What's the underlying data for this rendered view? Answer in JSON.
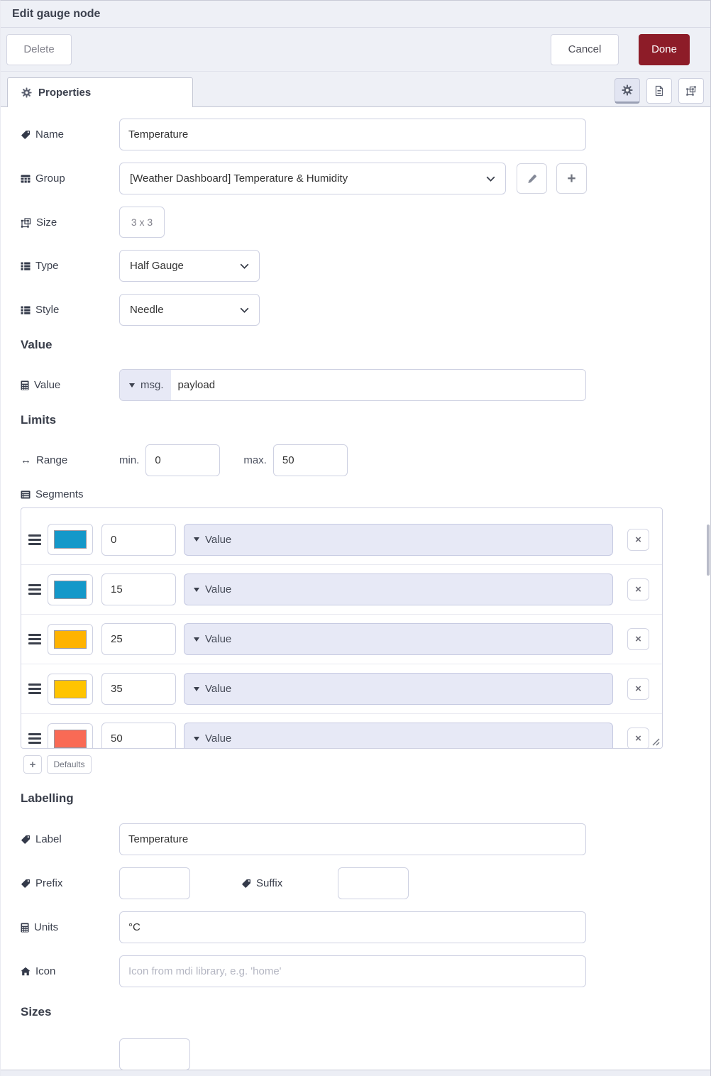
{
  "header": {
    "title": "Edit gauge node"
  },
  "toolbar": {
    "delete": "Delete",
    "cancel": "Cancel",
    "done": "Done"
  },
  "tabs": {
    "properties": "Properties"
  },
  "form": {
    "name": {
      "label": "Name",
      "value": "Temperature"
    },
    "group": {
      "label": "Group",
      "value": "[Weather Dashboard] Temperature & Humidity"
    },
    "size": {
      "label": "Size",
      "value": "3 x 3"
    },
    "type": {
      "label": "Type",
      "value": "Half Gauge"
    },
    "style": {
      "label": "Style",
      "value": "Needle"
    },
    "value_section": {
      "heading": "Value",
      "label": "Value",
      "prop_type": "msg.",
      "prop_value": "payload"
    },
    "limits": {
      "heading": "Limits",
      "range_label": "Range",
      "min_label": "min.",
      "min_value": "0",
      "max_label": "max.",
      "max_value": "50",
      "segments_label": "Segments",
      "segments": [
        {
          "color": "#1498c9",
          "value": "0",
          "type": "Value",
          "speckled": false
        },
        {
          "color": "#1498c9",
          "value": "15",
          "type": "Value",
          "speckled": false
        },
        {
          "color": "#ffb300",
          "value": "25",
          "type": "Value",
          "speckled": false
        },
        {
          "color": "#ffc400",
          "value": "35",
          "type": "Value",
          "speckled": true
        },
        {
          "color": "#f96a55",
          "value": "50",
          "type": "Value",
          "speckled": false
        }
      ],
      "remove_icon": "×",
      "add_label": "+",
      "defaults_label": "Defaults"
    },
    "labelling": {
      "heading": "Labelling",
      "label": {
        "label": "Label",
        "value": "Temperature"
      },
      "prefix": {
        "label": "Prefix",
        "value": ""
      },
      "suffix": {
        "label": "Suffix",
        "value": ""
      },
      "units": {
        "label": "Units",
        "value": "°C"
      },
      "icon": {
        "label": "Icon",
        "placeholder": "Icon from mdi library, e.g. 'home'"
      }
    },
    "sizes": {
      "heading": "Sizes"
    }
  },
  "colors": {
    "done_button": "#8d1c28",
    "typed_input_bg": "#e7e9f6",
    "segment_blue": "#1498c9",
    "segment_amber": "#ffb300",
    "segment_speckled_amber": "#ffc400",
    "segment_red": "#f96a55"
  }
}
